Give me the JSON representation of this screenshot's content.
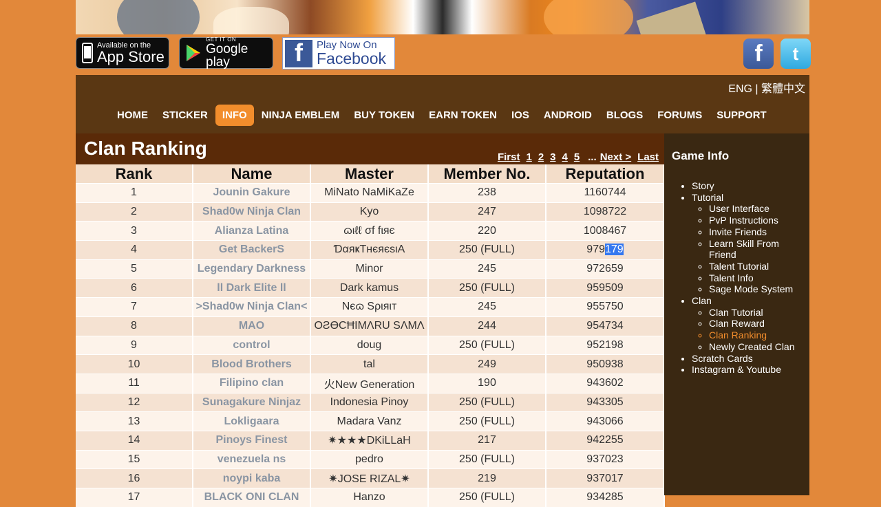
{
  "stores": {
    "appstore_small": "Available on the",
    "appstore_big": "App Store",
    "gplay_small": "GET IT ON",
    "gplay_big": "Google play",
    "fb_line1": "Play Now On",
    "fb_line2": "Facebook"
  },
  "social": {
    "fb": "f",
    "tw": "t"
  },
  "lang": {
    "eng": "ENG",
    "sep": " | ",
    "zh": "繁體中文"
  },
  "nav": [
    "HOME",
    "STICKER",
    "INFO",
    "NINJA EMBLEM",
    "BUY TOKEN",
    "EARN TOKEN",
    "IOS",
    "ANDROID",
    "BLOGS",
    "FORUMS",
    "SUPPORT"
  ],
  "nav_active": "INFO",
  "page_title": "Clan Ranking",
  "pager": {
    "first": "First",
    "pages": [
      "1",
      "2",
      "3",
      "4",
      "5"
    ],
    "dots": "...",
    "next": "Next >",
    "last": "Last"
  },
  "table": {
    "headers": [
      "Rank",
      "Name",
      "Master",
      "Member No.",
      "Reputation"
    ],
    "rows": [
      [
        "1",
        "Jounin Gakure",
        "MiNato NaMiKaZe",
        "238",
        "1160744"
      ],
      [
        "2",
        "Shad0w Ninja Clan",
        "Kyo",
        "247",
        "1098722"
      ],
      [
        "3",
        "Alianza Latina",
        "ɷιℓℓ σf fιяє",
        "220",
        "1008467"
      ],
      [
        "4",
        "Get BackerS",
        "ƊαяҝТнєяєѕιA",
        "250 (FULL)",
        "979179"
      ],
      [
        "5",
        "Legendary Darkness",
        "Minor",
        "245",
        "972659"
      ],
      [
        "6",
        "ll Dark Elite ll",
        "Dark kamus",
        "250 (FULL)",
        "959509"
      ],
      [
        "7",
        ">Shad0w Ninja Clan<",
        "Nєɷ Sριяιт",
        "245",
        "955750"
      ],
      [
        "8",
        "MAO",
        "OƧƟCĦIMΛRU SΛMΛ",
        "244",
        "954734"
      ],
      [
        "9",
        "control",
        "doug",
        "250 (FULL)",
        "952198"
      ],
      [
        "10",
        "Blood Brothers",
        "tal",
        "249",
        "950938"
      ],
      [
        "11",
        "Filipino clan",
        "火New Generation",
        "190",
        "943602"
      ],
      [
        "12",
        "Sunagakure Ninjaz",
        "Indonesia Pinoy",
        "250 (FULL)",
        "943305"
      ],
      [
        "13",
        "Lokligaara",
        "Madara Vanz",
        "250 (FULL)",
        "943066"
      ],
      [
        "14",
        "Pinoys Finest",
        "✷★★★DKiLLaH",
        "217",
        "942255"
      ],
      [
        "15",
        "venezuela ns",
        "pedro",
        "250 (FULL)",
        "937023"
      ],
      [
        "16",
        "noypi kaba",
        "✷JOSE RIZAL✷",
        "219",
        "937017"
      ],
      [
        "17",
        "BLACK ONI CLAN",
        "Hanzo",
        "250 (FULL)",
        "934285"
      ]
    ]
  },
  "sidebar": {
    "title": "Game Info",
    "items": [
      {
        "label": "Story"
      },
      {
        "label": "Tutorial",
        "children": [
          "User Interface",
          "PvP Instructions",
          "Invite Friends",
          "Learn Skill From Friend",
          "Talent Tutorial",
          "Talent Info",
          "Sage Mode System"
        ]
      },
      {
        "label": "Clan",
        "children": [
          "Clan Tutorial",
          "Clan Reward",
          "Clan Ranking",
          "Newly Created Clan"
        ]
      },
      {
        "label": "Scratch Cards"
      },
      {
        "label": "Instagram & Youtube"
      }
    ],
    "current": "Clan Ranking"
  },
  "colors": {
    "bg": "#e2883a",
    "nav": "#5a3713",
    "active": "#f28d2c",
    "title": "#5a2a08",
    "sidebar": "#3a2812"
  }
}
